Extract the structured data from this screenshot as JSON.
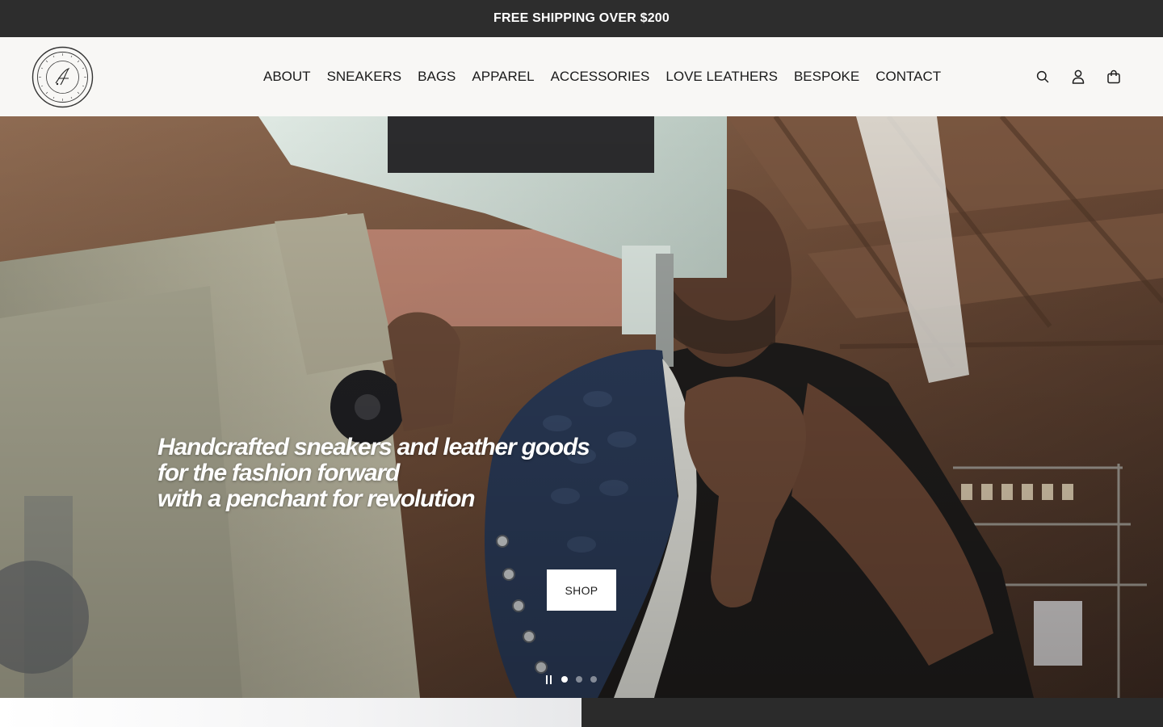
{
  "announcement": {
    "text": "FREE SHIPPING OVER $200"
  },
  "logo": {
    "alt": "brand seal logo"
  },
  "nav": {
    "items": [
      {
        "label": "ABOUT"
      },
      {
        "label": "SNEAKERS"
      },
      {
        "label": "BAGS"
      },
      {
        "label": "APPAREL"
      },
      {
        "label": "ACCESSORIES"
      },
      {
        "label": "LOVE LEATHERS"
      },
      {
        "label": "BESPOKE"
      },
      {
        "label": "CONTACT"
      }
    ]
  },
  "header_icons": [
    "search-icon",
    "account-icon",
    "cart-icon"
  ],
  "hero": {
    "headline_lines": [
      "Handcrafted sneakers and leather goods",
      "for the fashion forward",
      "with a penchant for revolution"
    ],
    "cta_label": "SHOP",
    "slides": {
      "count": 3,
      "active": 1
    }
  },
  "colors": {
    "announcement_bg": "#2d2d2d",
    "header_bg": "#f8f7f5",
    "button_bg": "#ffffff",
    "text": "#1d1d1d"
  }
}
